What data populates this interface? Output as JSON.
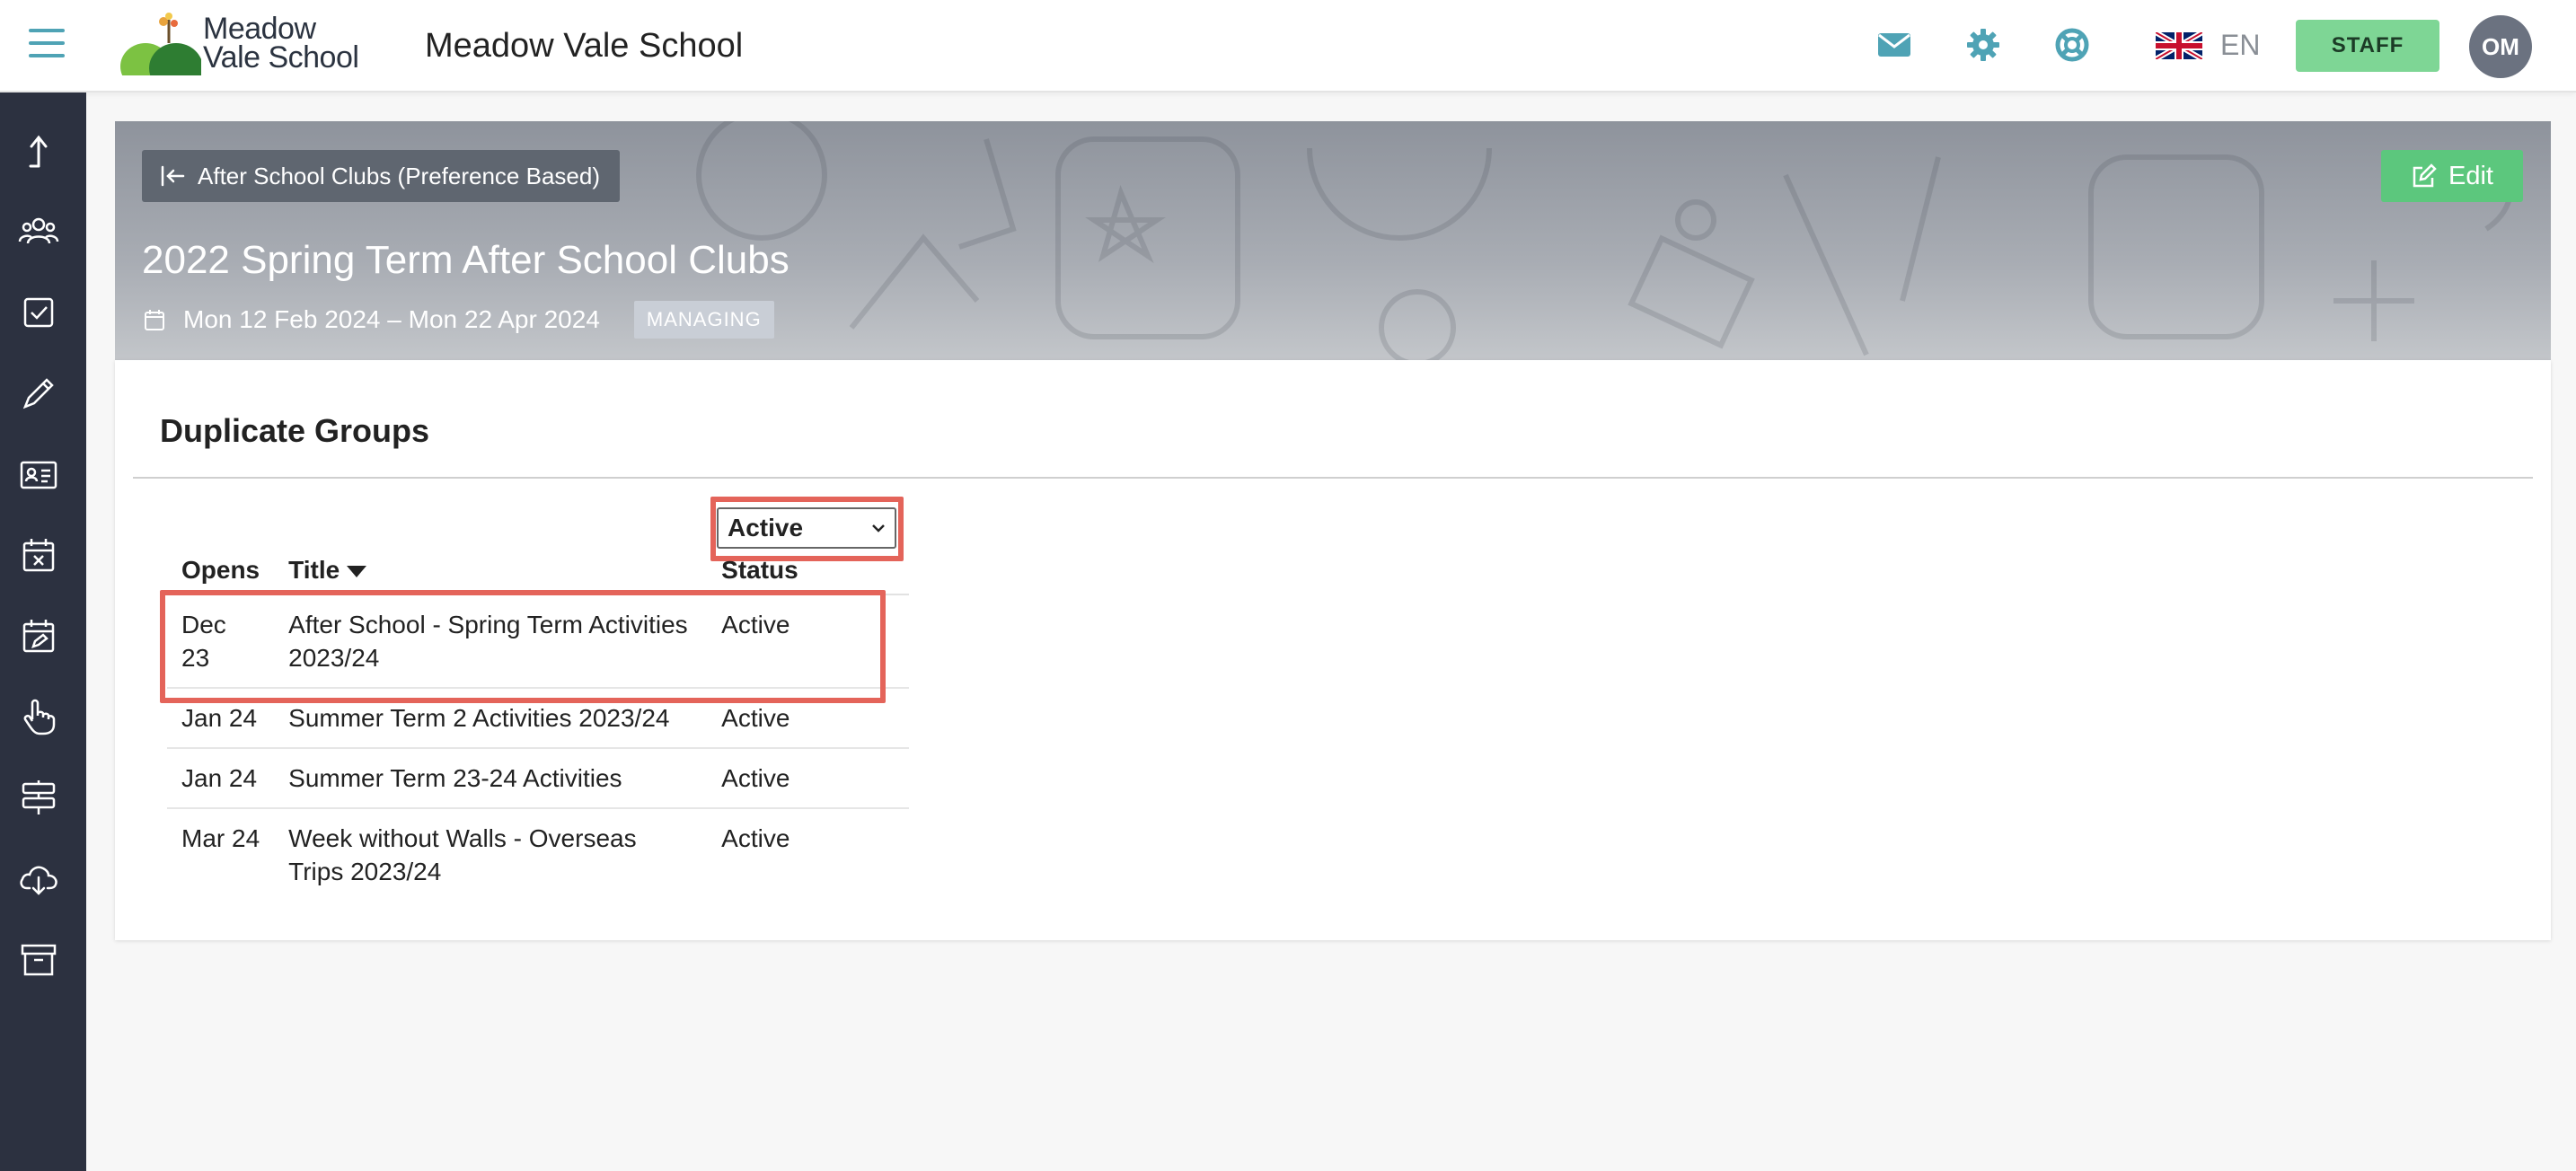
{
  "header": {
    "logo_line1": "Meadow",
    "logo_line2": "Vale School",
    "school_name": "Meadow Vale School",
    "language": "EN",
    "role_button": "STAFF",
    "avatar_initials": "OM",
    "icons": [
      "menu-icon",
      "mail-icon",
      "gear-icon",
      "lifebuoy-icon",
      "uk-flag-icon"
    ]
  },
  "sidebar": {
    "icons": [
      "upload-icon",
      "people-icon",
      "checkbox-icon",
      "pencil-icon",
      "id-card-icon",
      "calendar-x-icon",
      "calendar-edit-icon",
      "hand-pointer-icon",
      "signpost-icon",
      "cloud-download-icon",
      "archive-icon"
    ]
  },
  "hero": {
    "back_label": "After School Clubs (Preference Based)",
    "edit_label": "Edit",
    "title": "2022 Spring Term After School Clubs",
    "dates": "Mon 12 Feb 2024 – Mon 22 Apr 2024",
    "badge": "MANAGING"
  },
  "content": {
    "section_title": "Duplicate Groups",
    "filter_value": "Active",
    "columns": {
      "opens": "Opens",
      "title": "Title",
      "status": "Status"
    },
    "rows": [
      {
        "opens": "Dec 23",
        "title": "After School - Spring Term Activities 2023/24",
        "status": "Active"
      },
      {
        "opens": "Jan 24",
        "title": "Summer Term 2 Activities 2023/24",
        "status": "Active"
      },
      {
        "opens": "Jan 24",
        "title": "Summer Term 23-24 Activities",
        "status": "Active"
      },
      {
        "opens": "Mar 24",
        "title": "Week without Walls - Overseas Trips 2023/24",
        "status": "Active"
      }
    ]
  },
  "colors": {
    "accent_teal": "#4fa3b5",
    "staff_green": "#7ed695",
    "edit_green": "#5cc77d",
    "sidebar_bg": "#2c3140",
    "highlight_red": "#e4645a"
  }
}
